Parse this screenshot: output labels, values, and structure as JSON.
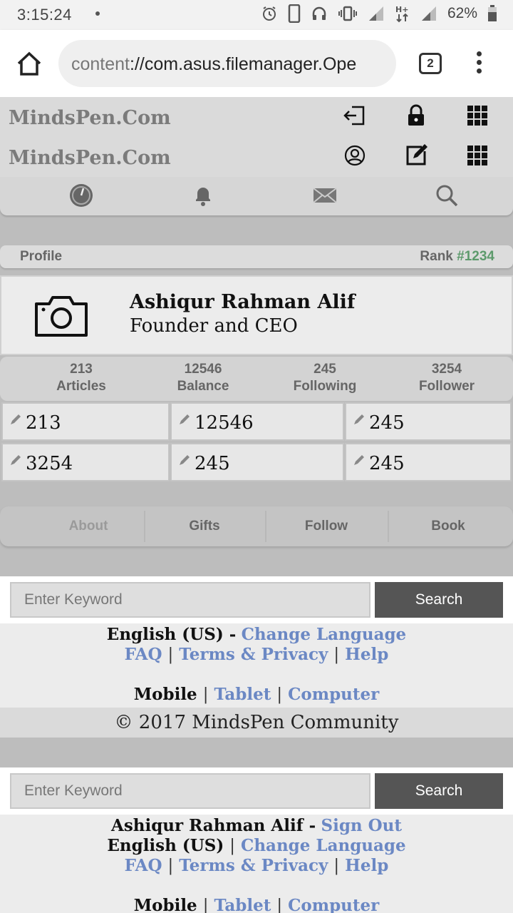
{
  "status_bar": {
    "time": "3:15:24",
    "battery": "62%"
  },
  "browser": {
    "url_scheme": "content",
    "url_rest": "://com.asus.filemanager.Ope",
    "tab_count": "2"
  },
  "site": {
    "brand_line_1": "MindsPen.Com",
    "brand_line_2": "MindsPen.Com"
  },
  "profile_bar": {
    "label": "Profile",
    "rank_label": "Rank",
    "rank_value": "#1234",
    "rank_color": "#5d9a6c"
  },
  "profile": {
    "name": "Ashiqur Rahman Alif",
    "title": "Founder and CEO"
  },
  "stats": [
    {
      "value": "213",
      "label": "Articles"
    },
    {
      "value": "12546",
      "label": "Balance"
    },
    {
      "value": "245",
      "label": "Following"
    },
    {
      "value": "3254",
      "label": "Follower"
    }
  ],
  "grid": [
    "213",
    "12546",
    "245",
    "3254",
    "245",
    "245"
  ],
  "tabs": [
    "About",
    "Gifts",
    "Follow",
    "Book"
  ],
  "search": {
    "placeholder": "Enter Keyword",
    "button": "Search"
  },
  "footer1": {
    "language_current": "English (US) -",
    "change_language": "Change Language",
    "faq": "FAQ",
    "terms": "Terms & Privacy",
    "help": "Help",
    "mobile": "Mobile",
    "tablet": "Tablet",
    "computer": "Computer",
    "copyright": "© 2017 MindsPen Community"
  },
  "footer2": {
    "user": "Ashiqur Rahman Alif -",
    "sign_out": "Sign Out",
    "language_current": "English (US)",
    "change_language": "Change Language",
    "faq": "FAQ",
    "terms": "Terms & Privacy",
    "help": "Help",
    "mobile": "Mobile",
    "tablet": "Tablet",
    "computer": "Computer"
  },
  "colors": {
    "link": "#6b88c4",
    "brand": "#7b7b7b",
    "search_button": "#555555"
  }
}
